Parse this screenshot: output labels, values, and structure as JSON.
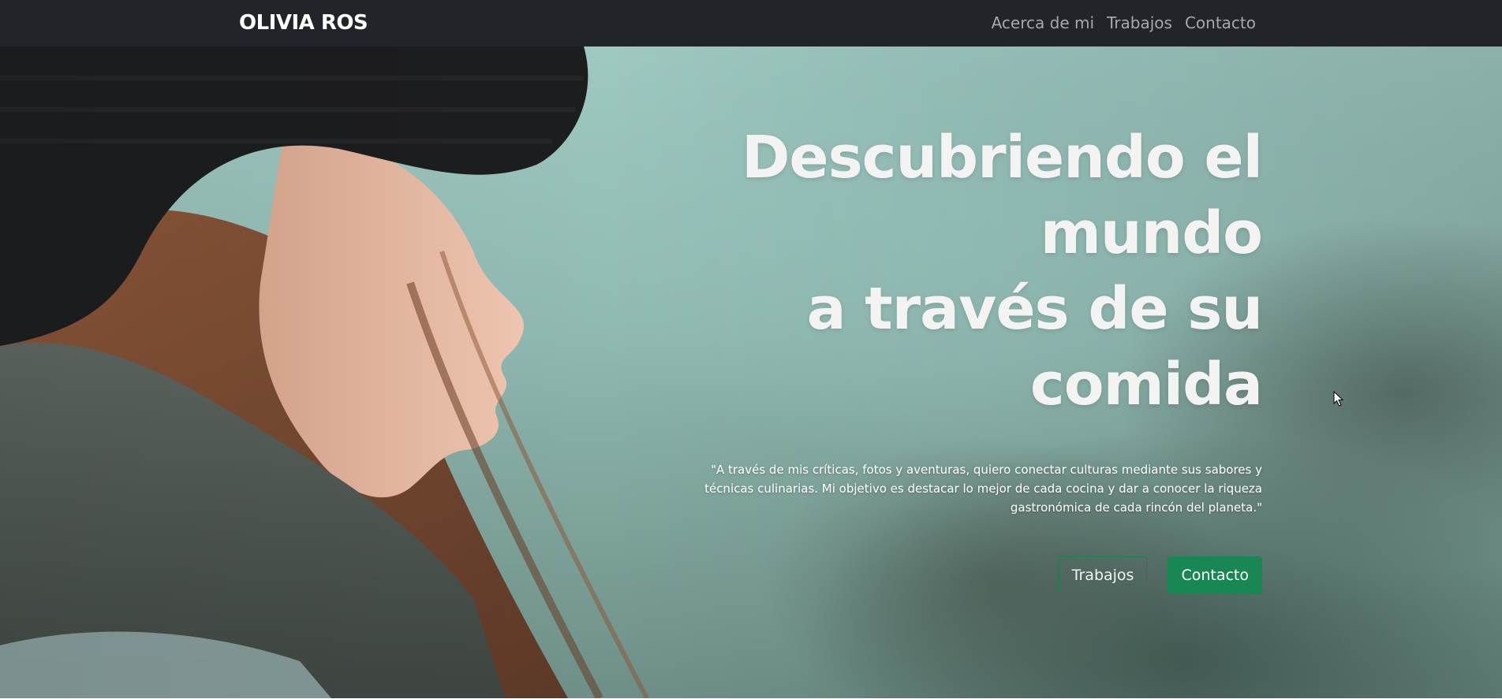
{
  "navbar": {
    "brand": "OLIVIA ROS",
    "links": [
      "Acerca de mi",
      "Trabajos",
      "Contacto"
    ]
  },
  "hero": {
    "title_lines": [
      "Descubriendo el",
      "mundo",
      "a través de su",
      "comida"
    ],
    "quote": "\"A través de mis críticas, fotos y aventuras, quiero conectar culturas mediante sus sabores y técnicas culinarias. Mi objetivo es destacar lo mejor de cada cocina y dar a conocer la riqueza gastronómica de cada rincón del planeta.\"",
    "buttons": {
      "primary": "Contacto",
      "secondary": "Trabajos"
    }
  },
  "colors": {
    "navbar_bg": "#212529",
    "nav_link": "#a6a8ab",
    "accent_green": "#198754",
    "hero_text": "#f3f3f3"
  },
  "icons": {
    "cursor": "mouse-pointer-icon"
  }
}
